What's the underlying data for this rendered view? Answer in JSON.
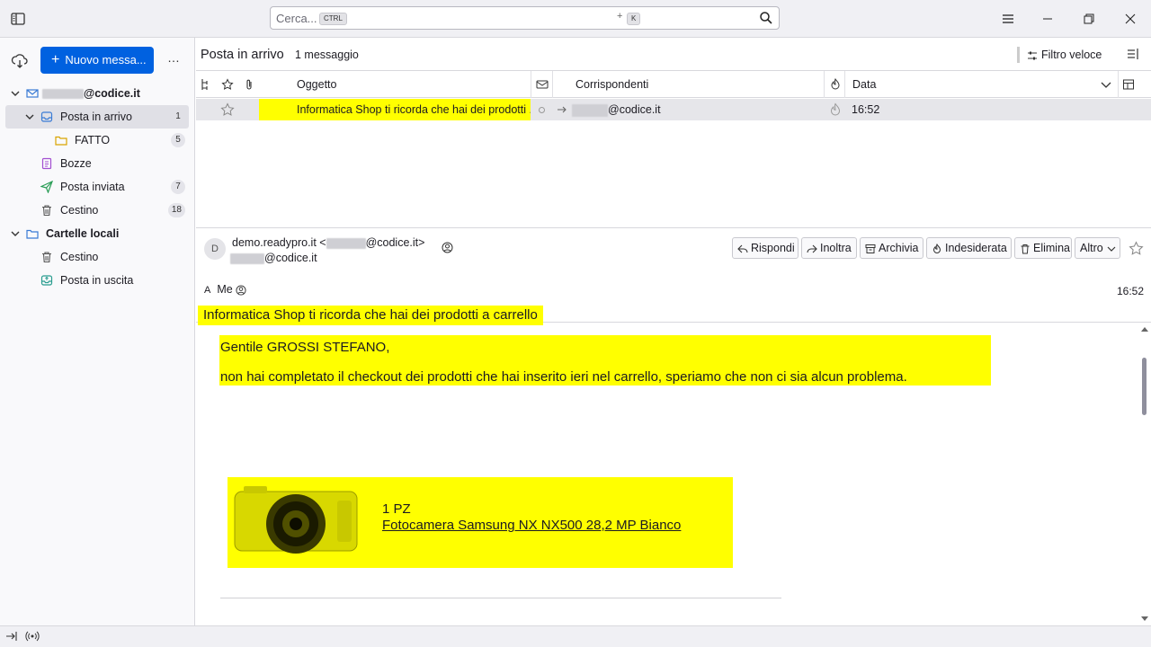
{
  "search": {
    "placeholder": "Cerca...",
    "key1": "CTRL",
    "plus": "+",
    "key2": "K"
  },
  "sidebar": {
    "new_message": "Nuovo messa...",
    "more": "…",
    "account_suffix": "@codice.it",
    "folders": [
      {
        "label": "Posta in arrivo",
        "count": "1"
      },
      {
        "label": "FATTO",
        "count": "5"
      },
      {
        "label": "Bozze",
        "count": ""
      },
      {
        "label": "Posta inviata",
        "count": "7"
      },
      {
        "label": "Cestino",
        "count": "18"
      }
    ],
    "local_folders": "Cartelle locali",
    "local": [
      {
        "label": "Cestino"
      },
      {
        "label": "Posta in uscita"
      }
    ]
  },
  "thread": {
    "title": "Posta in arrivo",
    "count": "1 messaggio",
    "quick_filter": "Filtro veloce",
    "columns": {
      "subject": "Oggetto",
      "correspondents": "Corrispondenti",
      "date": "Data"
    },
    "row": {
      "subject": "Informatica Shop ti ricorda che hai dei prodotti ...",
      "correspondent_suffix": "@codice.it",
      "date": "16:52"
    }
  },
  "message": {
    "avatar": "D",
    "from_name": "demo.readypro.it <",
    "from_suffix": "@codice.it>",
    "to_suffix": "@codice.it",
    "recipients_label": "Me",
    "date": "16:52",
    "subject": "Informatica Shop ti ricorda che hai dei prodotti a carrello",
    "actions": [
      "Rispondi",
      "Inoltra",
      "Archivia",
      "Indesiderata",
      "Elimina",
      "Altro"
    ],
    "body": {
      "greeting": "Gentile GROSSI STEFANO,",
      "text": "non hai completato il checkout dei prodotti che hai inserito ieri nel carrello, speriamo che non ci sia alcun problema.",
      "qty": "1 PZ",
      "product": "Fotocamera Samsung NX NX500 28,2 MP Bianco"
    }
  },
  "colors": {
    "accent": "#0061e0",
    "highlight": "#ffff00"
  }
}
